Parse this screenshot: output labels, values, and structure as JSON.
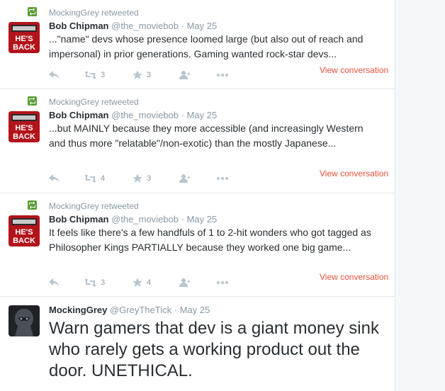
{
  "tweets": [
    {
      "retweeted_by": "MockingGrey retweeted",
      "name": "Bob Chipman",
      "handle": "@the_moviebob",
      "sep": "·",
      "time": "May 25",
      "text": "...\"name\" devs whose presence loomed large (but also out of reach and impersonal) in prior generations. Gaming wanted rock-star devs...",
      "retweets": "3",
      "favorites": "3",
      "view_conversation": "View conversation"
    },
    {
      "retweeted_by": "MockingGrey retweeted",
      "name": "Bob Chipman",
      "handle": "@the_moviebob",
      "sep": "·",
      "time": "May 25",
      "text": "...but MAINLY because they more accessible (and increasingly Western and thus more \"relatable\"/non-exotic) than the mostly Japanese...",
      "retweets": "4",
      "favorites": "3",
      "view_conversation": "View conversation"
    },
    {
      "retweeted_by": "MockingGrey retweeted",
      "name": "Bob Chipman",
      "handle": "@the_moviebob",
      "sep": "·",
      "time": "May 25",
      "text": "It feels like there's a few handfuls of 1 to 2-hit wonders who got tagged as Philosopher Kings PARTIALLY because they worked one big game...",
      "retweets": "3",
      "favorites": "4",
      "view_conversation": "View conversation"
    },
    {
      "name": "MockingGrey",
      "handle": "@GreyTheTick",
      "sep": "·",
      "time": "May 25",
      "text": "Warn gamers that dev is a giant money sink who rarely gets a working product out the door. UNETHICAL."
    }
  ],
  "avatar_text": "HE'S BACK",
  "colors": {
    "retweet_green": "#5c9e35",
    "link_red": "#e8503a",
    "muted": "#8899a6",
    "icon": "#b8c5cf"
  },
  "icons": [
    "retweet-icon",
    "reply-icon",
    "favorite-icon",
    "follow-icon",
    "more-icon"
  ]
}
